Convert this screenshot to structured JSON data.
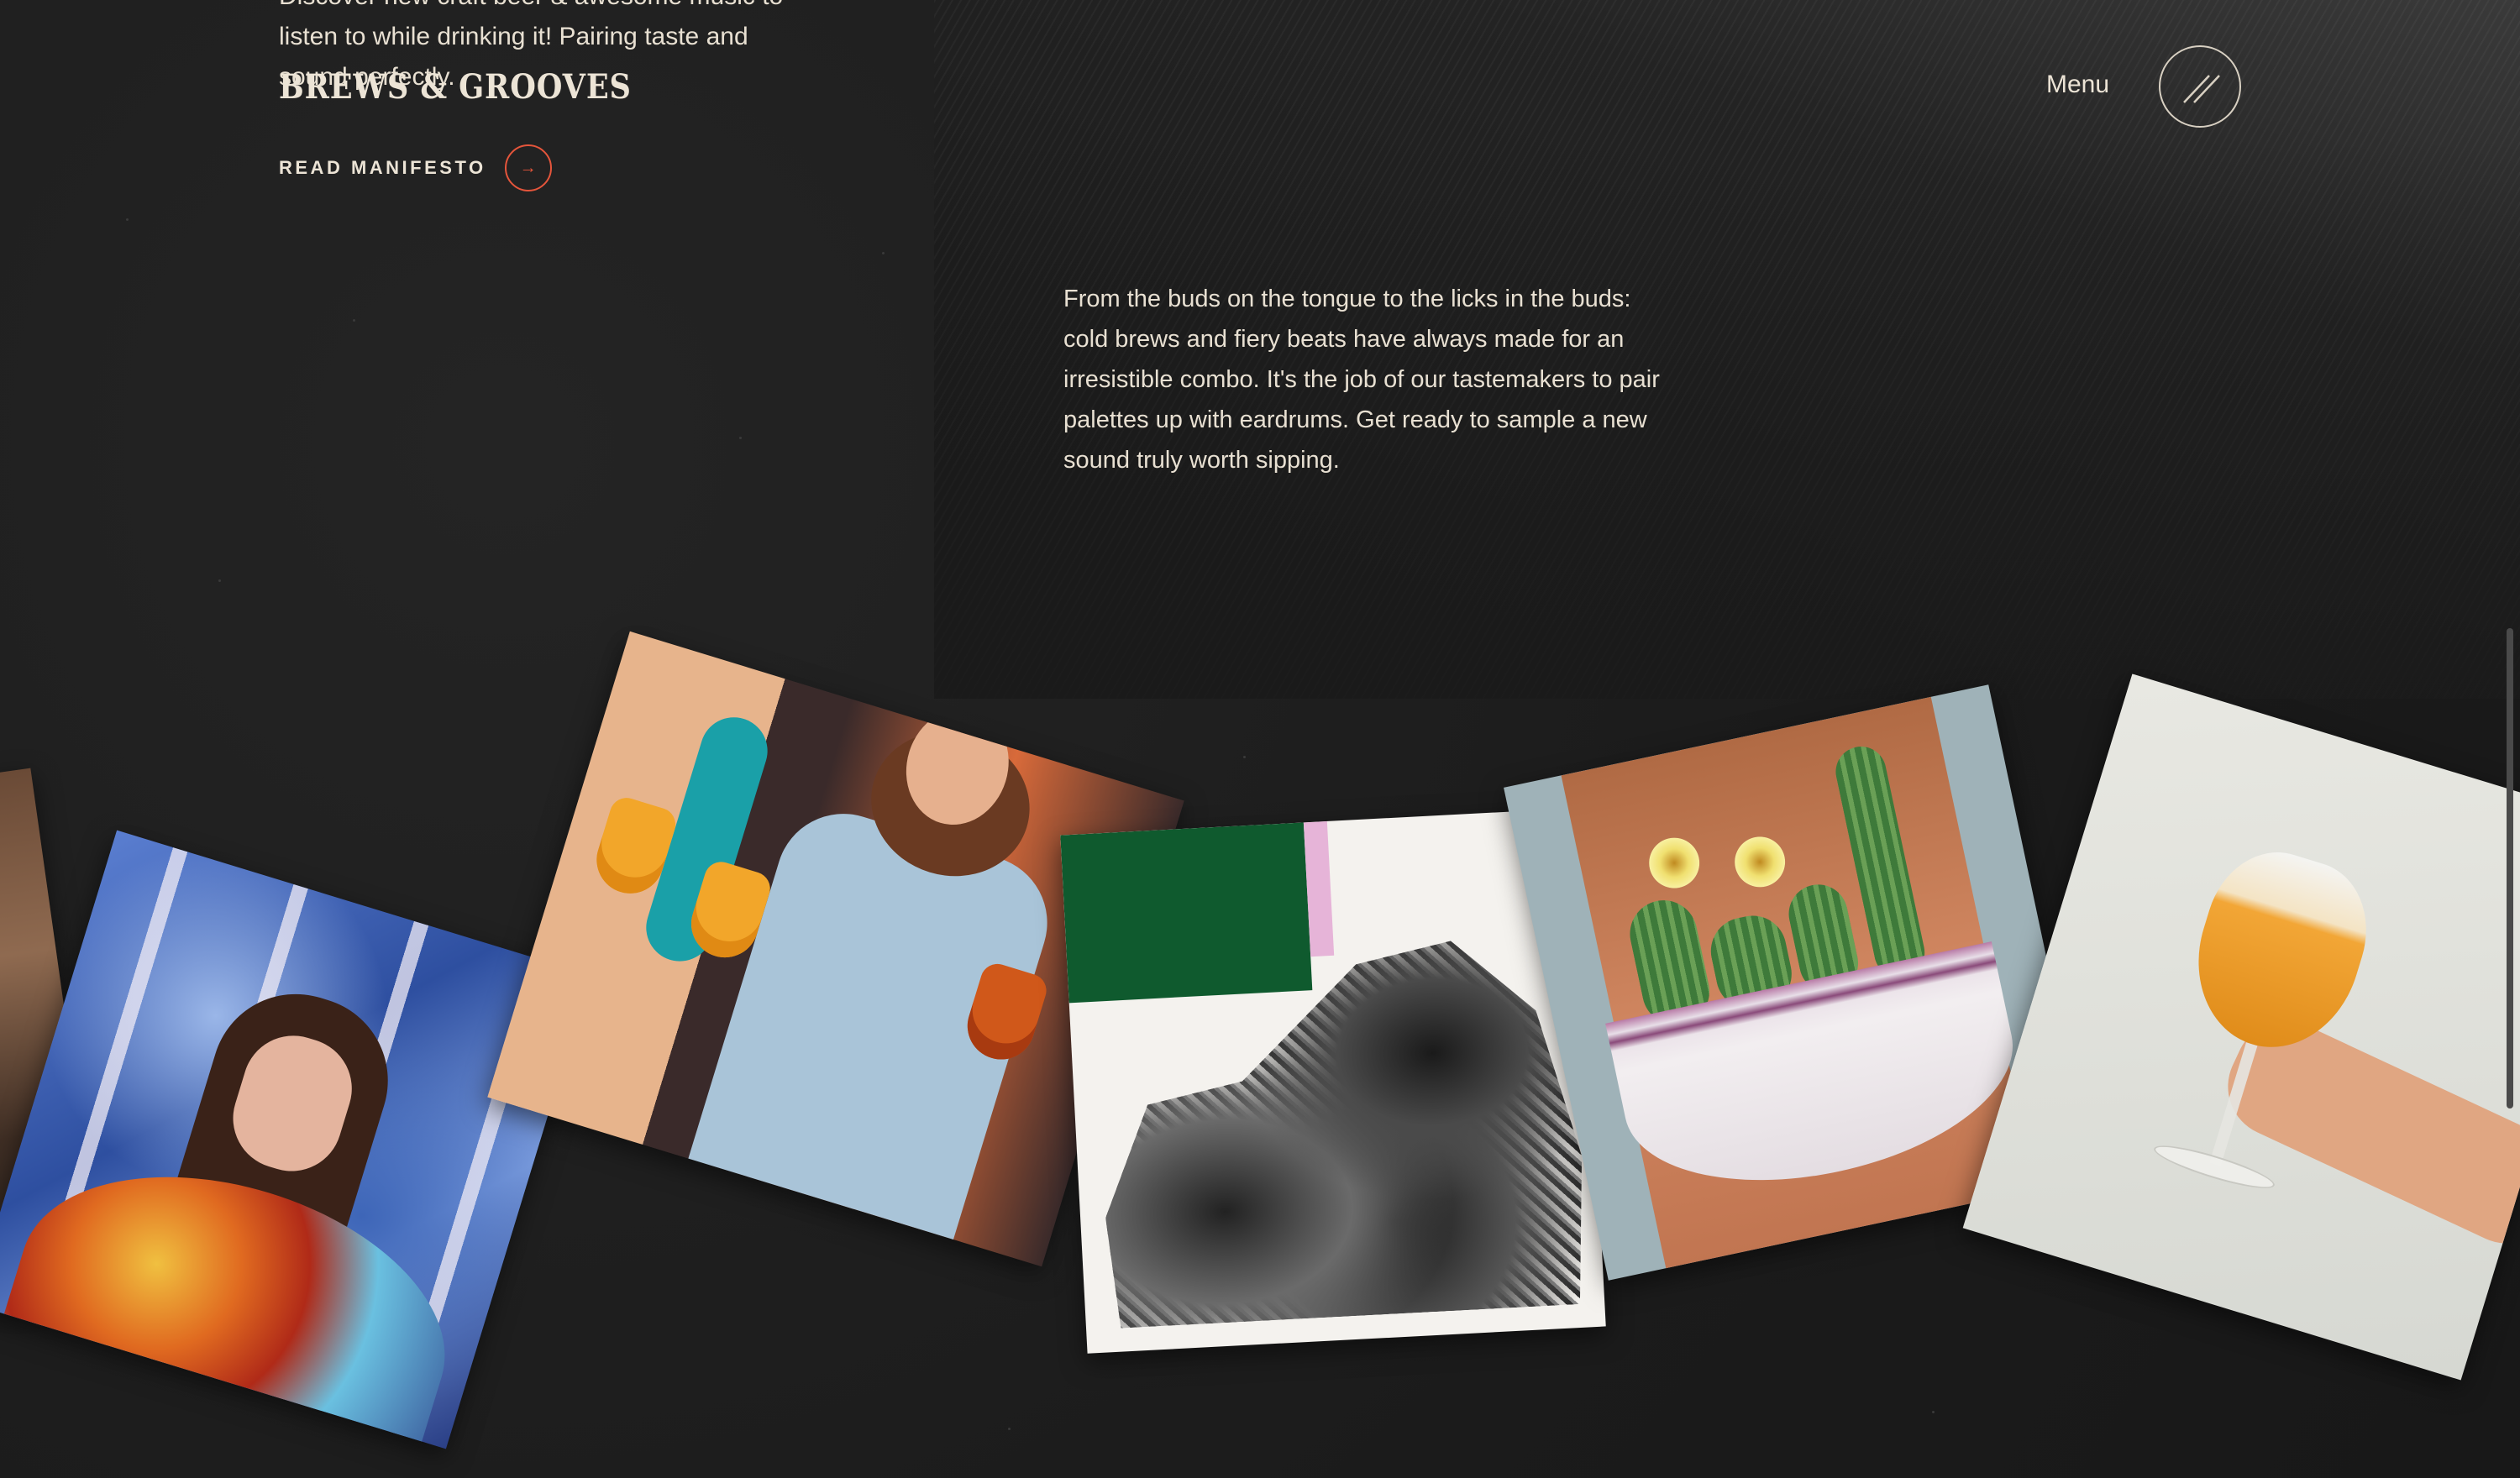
{
  "brand": {
    "logo_text": "BREWS & GROOVES"
  },
  "intro": {
    "lines": [
      "Discover new craft beer & awesome music to",
      "listen to while drinking it! Pairing taste and",
      "sound perfectly."
    ]
  },
  "manifesto": {
    "label": "READ MANIFESTO",
    "icon": "arrow-right-icon"
  },
  "header": {
    "menu_label": "Menu",
    "menu_icon": "double-slash-icon"
  },
  "about": {
    "paragraph": "From the buds on the tongue to the licks in the buds: cold brews and fiery beats have always made for an irresistible combo. It's the job of our tastemakers to pair palettes up with eardrums. Get ready to sample a new sound truly worth sipping."
  },
  "gallery": {
    "items": [
      {
        "name": "cropped-photo"
      },
      {
        "name": "artist-portrait-blue-swirl"
      },
      {
        "name": "women-holding-beers"
      },
      {
        "name": "album-art-machinery"
      },
      {
        "name": "cactus-collage"
      },
      {
        "name": "beer-glass-in-hand"
      }
    ]
  },
  "colors": {
    "accent": "#e5553b",
    "text": "#ece4d6",
    "background": "#1c1c1c"
  }
}
